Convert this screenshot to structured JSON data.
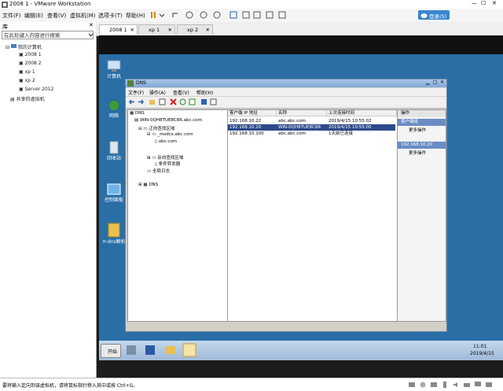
{
  "window": {
    "title": "2008 1 - VMware Workstation"
  },
  "menu": {
    "items": [
      "文件(F)",
      "编辑(E)",
      "查看(V)",
      "虚拟机(M)",
      "选项卡(T)",
      "帮助(H)"
    ],
    "login": "登录(S)"
  },
  "vm_tabs": [
    {
      "label": "2008 1"
    },
    {
      "label": "xp 1"
    },
    {
      "label": "xp 2"
    }
  ],
  "library": {
    "title": "库",
    "search_placeholder": "在此处键入内容进行搜索",
    "root": "我的计算机",
    "items": [
      "2008 1",
      "2008 2",
      "xp 1",
      "xp 2",
      "Server 2012"
    ],
    "shared": "共享的虚拟机"
  },
  "desktop_icons": [
    "计算机",
    "网络",
    "回收站",
    "控制面板",
    "rr-dns解析"
  ],
  "mmc": {
    "title": "DNS",
    "menu": [
      "文件(F)",
      "操作(A)",
      "查看(V)",
      "帮助(H)"
    ],
    "tree": [
      "DNS",
      "WIN-0QH8TUE8C8R.abc.com",
      "正向查找区域",
      "_msdcs.abc.com",
      "abc.com",
      "反向查找区域",
      "条件转发器",
      "全局日志",
      "DNS"
    ],
    "columns": [
      "客户端 IP 地址",
      "名称",
      "上次连接时间"
    ],
    "rows": [
      {
        "ip": "192.168.10.22",
        "name": "abc.abc.com",
        "time": "2019/4/15 10:55:02",
        "selected": false
      },
      {
        "ip": "192.168.10.20",
        "name": "WIN-0QH8TUE8C8R",
        "time": "2019/4/15 10:55:00",
        "selected": true
      },
      {
        "ip": "192.168.10.100",
        "name": "abc.abc.com",
        "time": "1天前已连接",
        "selected": false
      }
    ],
    "actions": {
      "title": "操作",
      "section1": "客户端组",
      "more1": "更多操作",
      "section2": "192.168.10.20",
      "more2": "更多操作"
    }
  },
  "taskbar": {
    "start": "开始",
    "time": "11:01",
    "date": "2019/4/15"
  },
  "status": {
    "text": "要将输入定向到该虚拟机，请将鼠标指针移入其中或按 Ctrl+G。"
  }
}
